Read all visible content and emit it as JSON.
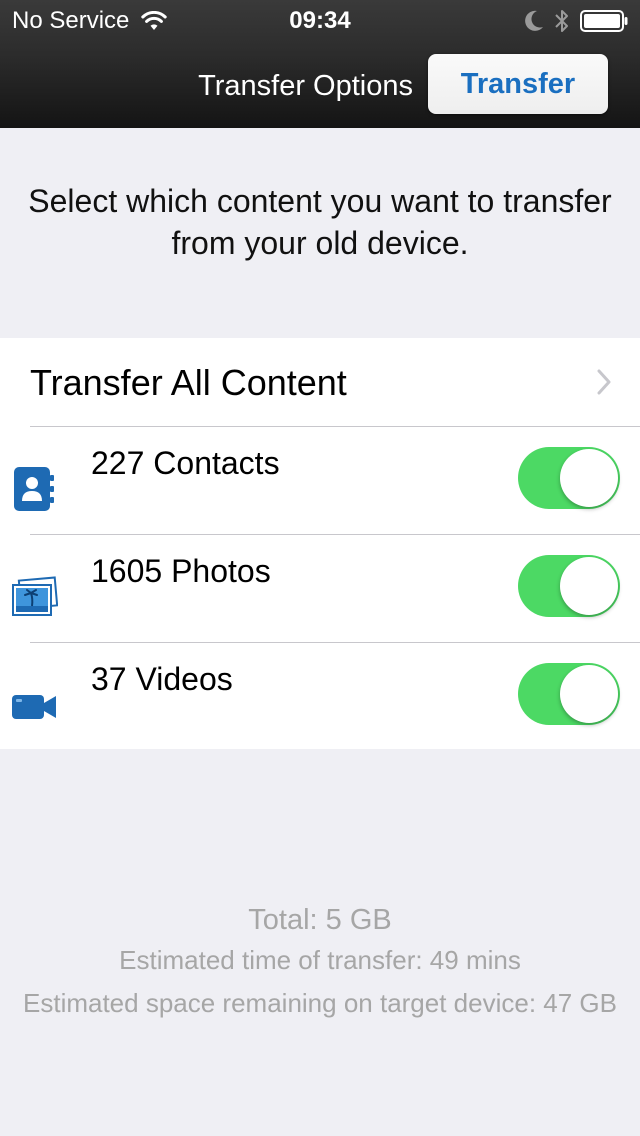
{
  "status_bar": {
    "carrier": "No Service",
    "time": "09:34",
    "icons": [
      "wifi-icon",
      "moon-icon",
      "bluetooth-icon",
      "battery-icon"
    ]
  },
  "nav": {
    "title": "Transfer Options",
    "transfer_button_label": "Transfer"
  },
  "instructions": "Select which content you want to transfer from your old device.",
  "list": {
    "transfer_all_label": "Transfer All Content",
    "items": [
      {
        "label": "227 Contacts",
        "icon": "contacts-icon",
        "enabled": true
      },
      {
        "label": "1605 Photos",
        "icon": "photos-icon",
        "enabled": true
      },
      {
        "label": "37 Videos",
        "icon": "video-camera-icon",
        "enabled": true
      }
    ]
  },
  "summary": {
    "total": "Total: 5 GB",
    "time": "Estimated time of transfer: 49 mins",
    "space": "Estimated space remaining on target device: 47 GB"
  },
  "colors": {
    "toggle_on": "#4cd964",
    "accent": "#1a6fc0",
    "icon_blue": "#1e6ab3",
    "background": "#efeff4",
    "summary_text": "#a6a6a6"
  }
}
